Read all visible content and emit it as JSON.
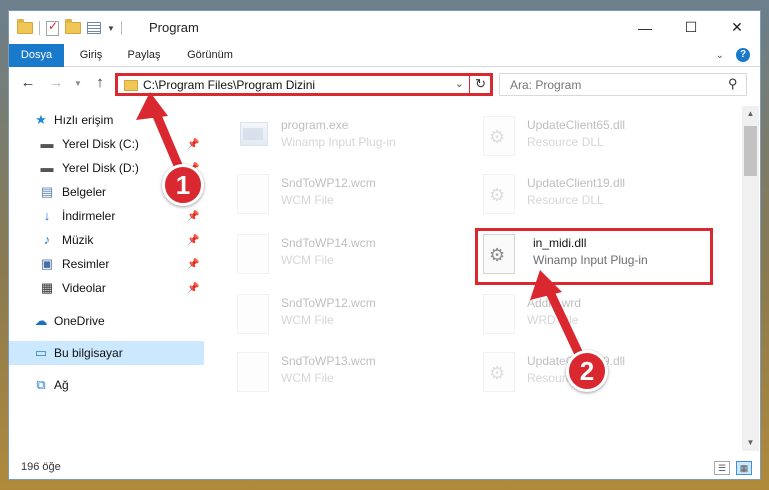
{
  "window": {
    "title": "Program",
    "minimize": "—",
    "maximize": "☐",
    "close": "✕"
  },
  "ribbon": {
    "tabs": [
      "Dosya",
      "Giriş",
      "Paylaş",
      "Görünüm"
    ],
    "expand_icon": "chevron-down-icon",
    "help_icon": "help-icon"
  },
  "navigation": {
    "address": "C:\\Program Files\\Program Dizini",
    "search_placeholder": "Ara: Program"
  },
  "sidebar": {
    "items": [
      {
        "label": "Hızlı erişim",
        "icon": "star-icon",
        "pinned": false
      },
      {
        "label": "Yerel Disk (C:)",
        "icon": "drive-icon",
        "pinned": true
      },
      {
        "label": "Yerel Disk (D:)",
        "icon": "drive-icon",
        "pinned": true
      },
      {
        "label": "Belgeler",
        "icon": "documents-icon",
        "pinned": true
      },
      {
        "label": "İndirmeler",
        "icon": "download-icon",
        "pinned": true
      },
      {
        "label": "Müzik",
        "icon": "music-icon",
        "pinned": true
      },
      {
        "label": "Resimler",
        "icon": "pictures-icon",
        "pinned": true
      },
      {
        "label": "Videolar",
        "icon": "video-icon",
        "pinned": true
      },
      {
        "label": "OneDrive",
        "icon": "cloud-icon",
        "pinned": false
      },
      {
        "label": "Bu bilgisayar",
        "icon": "computer-icon",
        "pinned": false,
        "selected": true
      },
      {
        "label": "Ağ",
        "icon": "network-icon",
        "pinned": false
      }
    ]
  },
  "files": [
    {
      "name": "program.exe",
      "desc": "Winamp Input Plug-in",
      "type": "exe",
      "faded": true
    },
    {
      "name": "UpdateClient65.dll",
      "desc": "Resource DLL",
      "type": "dll",
      "faded": true
    },
    {
      "name": "SndToWP12.wcm",
      "desc": "WCM File",
      "type": "doc",
      "faded": true
    },
    {
      "name": "UpdateClient19.dll",
      "desc": "Resource DLL",
      "type": "dll",
      "faded": true
    },
    {
      "name": "SndToWP14.wcm",
      "desc": "WCM File",
      "type": "doc",
      "faded": true
    },
    {
      "name": "in_midi.dll",
      "desc": "Winamp Input Plug-in",
      "type": "dll",
      "faded": false,
      "highlighted": true
    },
    {
      "name": "SndToWP12.wcm",
      "desc": "WCM File",
      "type": "doc",
      "faded": true
    },
    {
      "name": "Addr...wrd",
      "desc": "WRD File",
      "type": "doc",
      "faded": true
    },
    {
      "name": "SndToWP13.wcm",
      "desc": "WCM File",
      "type": "doc",
      "faded": true
    },
    {
      "name": "UpdateClient19.dll",
      "desc": "Resource DLL",
      "type": "dll",
      "faded": true
    }
  ],
  "status": {
    "count": "196 öğe"
  },
  "annotations": {
    "step1": "1",
    "step2": "2",
    "color": "#d9282f"
  }
}
